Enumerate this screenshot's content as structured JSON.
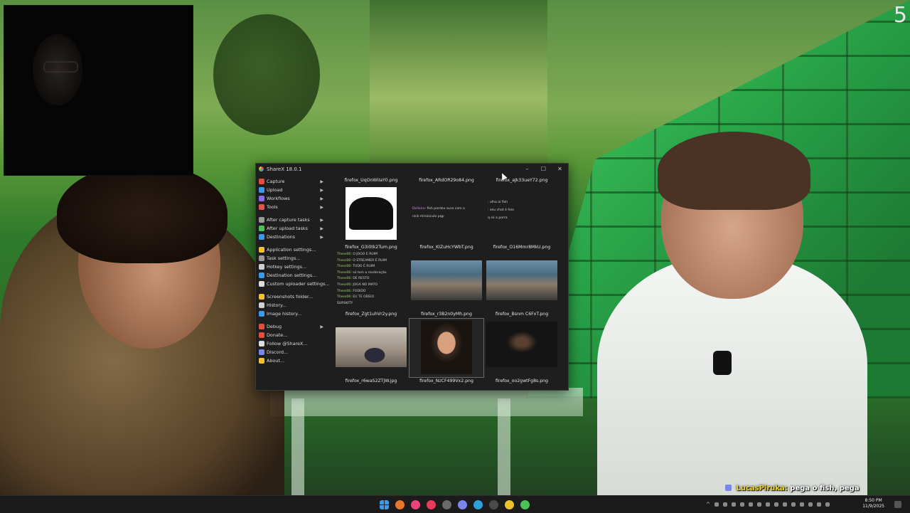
{
  "overlay": {
    "corner_number": "5"
  },
  "chat_overlay": {
    "user": "LucasPiruka:",
    "message": "pega o fish, pega"
  },
  "sharex": {
    "title": "ShareX 18.0.1",
    "controls": {
      "minimize": "–",
      "maximize": "☐",
      "close": "✕"
    },
    "menu": [
      {
        "label": "Capture",
        "icon_color": "#e84c3d",
        "has_submenu": true,
        "group": 1
      },
      {
        "label": "Upload",
        "icon_color": "#3b9be8",
        "has_submenu": true,
        "group": 1
      },
      {
        "label": "Workflows",
        "icon_color": "#8a6be8",
        "has_submenu": true,
        "group": 1
      },
      {
        "label": "Tools",
        "icon_color": "#e8544c",
        "has_submenu": true,
        "group": 1
      },
      {
        "label": "After capture tasks",
        "icon_color": "#9a9a9a",
        "has_submenu": true,
        "group": 2
      },
      {
        "label": "After upload tasks",
        "icon_color": "#4cc15a",
        "has_submenu": true,
        "group": 2
      },
      {
        "label": "Destinations",
        "icon_color": "#3b9be8",
        "has_submenu": true,
        "group": 2
      },
      {
        "label": "Application settings...",
        "icon_color": "#f2c12e",
        "has_submenu": false,
        "group": 3
      },
      {
        "label": "Task settings...",
        "icon_color": "#9a9a9a",
        "has_submenu": false,
        "group": 3
      },
      {
        "label": "Hotkey settings...",
        "icon_color": "#cfcfcf",
        "has_submenu": false,
        "group": 3
      },
      {
        "label": "Destination settings...",
        "icon_color": "#3b9be8",
        "has_submenu": false,
        "group": 3
      },
      {
        "label": "Custom uploader settings...",
        "icon_color": "#dcdcdc",
        "has_submenu": false,
        "group": 3
      },
      {
        "label": "Screenshots folder...",
        "icon_color": "#f2c12e",
        "has_submenu": false,
        "group": 4
      },
      {
        "label": "History...",
        "icon_color": "#cfcfcf",
        "has_submenu": false,
        "group": 4
      },
      {
        "label": "Image history...",
        "icon_color": "#3b9be8",
        "has_submenu": false,
        "group": 4
      },
      {
        "label": "Debug",
        "icon_color": "#e84c3d",
        "has_submenu": true,
        "group": 5
      },
      {
        "label": "Donate...",
        "icon_color": "#e84c3d",
        "has_submenu": false,
        "group": 5
      },
      {
        "label": "Follow @ShareX...",
        "icon_color": "#dcdcdc",
        "has_submenu": false,
        "group": 5
      },
      {
        "label": "Discord...",
        "icon_color": "#7a86e8",
        "has_submenu": false,
        "group": 5
      },
      {
        "label": "About...",
        "icon_color": "#f2c12e",
        "has_submenu": false,
        "group": 5
      }
    ],
    "files": [
      {
        "name": "firefox_UqOnWIIaY0.png",
        "thumb": "cap"
      },
      {
        "name": "firefox_ARdOR29o84.png",
        "thumb": "chat1"
      },
      {
        "name": "firefox_aJk33ueY72.png",
        "thumb": "chat2"
      },
      {
        "name": "firefox_G3i0tk2Tum.png",
        "thumb": "chat3"
      },
      {
        "name": "firefox_KIZuHcYWbT.png",
        "thumb": "photo-table"
      },
      {
        "name": "firefox_O16Mmr8MkU.png",
        "thumb": "photo-table"
      },
      {
        "name": "firefox_Zgt1uhVr2y.png",
        "thumb": "photo-room"
      },
      {
        "name": "firefox_r3B2n0yMh.png",
        "thumb": "photo-face",
        "selected": true
      },
      {
        "name": "firefox_Bsnm C6FxT.png",
        "thumb": "photo-dark"
      },
      {
        "name": "firefox_r6waS2ZTJW.jpg",
        "thumb": "none"
      },
      {
        "name": "firefox_NzCF499Vx2.png",
        "thumb": "none"
      },
      {
        "name": "firefox_oo2gwtFg8s.png",
        "thumb": "none"
      }
    ],
    "chat_previews": {
      "chat1": [
        {
          "nick": "Dolleiro",
          "text": ": fish perdeu aura com o"
        },
        {
          "nick": "",
          "text": "nick minúsculo pqp"
        }
      ],
      "chat2": [
        {
          "nick": "",
          "text": ": olha ai fish"
        },
        {
          "nick": "",
          "text": ": seu chat é feio"
        },
        {
          "nick": "",
          "text": "q só a porra"
        }
      ],
      "chat3": [
        {
          "nick": "Thess06",
          "text": ": O JOGO É RUIM"
        },
        {
          "nick": "Thess06",
          "text": ": O STREAMER É RUIM"
        },
        {
          "nick": "Thess06",
          "text": ": TUDO É RUIM"
        },
        {
          "nick": "Thess06",
          "text": ": só tem a moderação"
        },
        {
          "nick": "Thess06",
          "text": ": DE RESTO"
        },
        {
          "nick": "Thess06",
          "text": ": JOGA NO MATO"
        },
        {
          "nick": "Thess06",
          "text": ": FODIDO"
        },
        {
          "nick": "Thess06",
          "text": ": EU TE ODEIO"
        },
        {
          "nick": "",
          "text": "SURSKITY"
        }
      ]
    }
  },
  "taskbar": {
    "clock_time": "8:50 PM",
    "clock_date": "11/9/2025",
    "pinned": [
      {
        "name": "windows-start-icon",
        "color": "#3b9be8"
      },
      {
        "name": "firefox-icon",
        "color": "#e8772e"
      },
      {
        "name": "osu-icon",
        "color": "#e8447a"
      },
      {
        "name": "music-icon",
        "color": "#e83a5a"
      },
      {
        "name": "obs-icon",
        "color": "#6a6a6a"
      },
      {
        "name": "discord-icon",
        "color": "#7a86e8"
      },
      {
        "name": "refresh-icon",
        "color": "#2ea0d8"
      },
      {
        "name": "snipping-icon",
        "color": "#4a4a4a"
      },
      {
        "name": "chrome-icon",
        "color": "#e8c12e"
      },
      {
        "name": "sharex-icon",
        "color": "#4cc15a"
      }
    ]
  }
}
